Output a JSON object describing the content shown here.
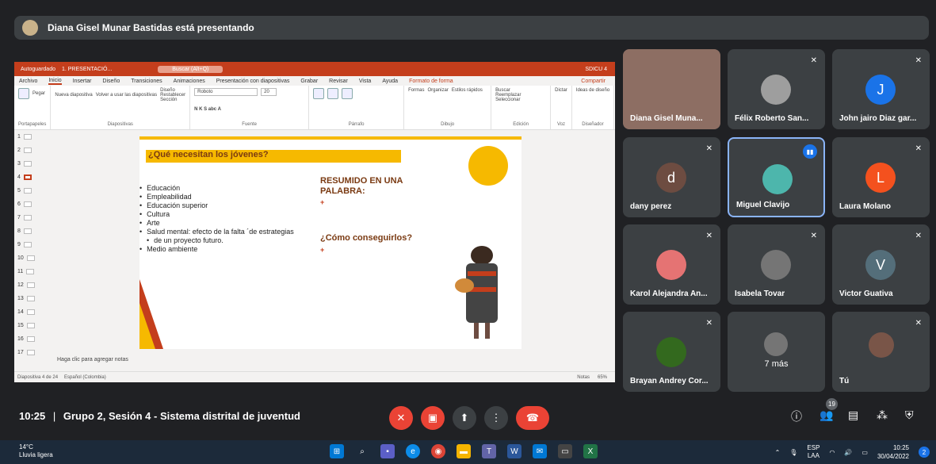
{
  "presenter_banner": "Diana Gisel Munar Bastidas está presentando",
  "ppt": {
    "autosave": "Autoguardado",
    "filename": "1. PRESENTACIÓ...",
    "search": "Buscar (Alt+Q)",
    "user": "SDICU 4",
    "menu": [
      "Archivo",
      "Inicio",
      "Insertar",
      "Diseño",
      "Transiciones",
      "Animaciones",
      "Presentación con diapositivas",
      "Grabar",
      "Revisar",
      "Vista",
      "Ayuda",
      "Formato de forma"
    ],
    "share": "Compartir",
    "groups": [
      "Portapapeles",
      "Diapositivas",
      "Fuente",
      "Párrafo",
      "Dibujo",
      "Edición",
      "Voz",
      "Diseñador"
    ],
    "paste": "Pegar",
    "new_slide": "Nueva diapositiva",
    "reuse": "Volver a usar las diapositivas",
    "layout": "Diseño",
    "reset": "Restablecer",
    "section": "Sección",
    "font": "Roboto",
    "size": "20",
    "forms": "Formas",
    "arrange": "Organizar",
    "styles": "Estilos rápidos",
    "find": "Buscar",
    "replace": "Reemplazar",
    "select": "Seleccionar",
    "dictate": "Dictar",
    "ideas": "Ideas de diseño",
    "slide_numbers": [
      "1",
      "2",
      "3",
      "4",
      "5",
      "6",
      "7",
      "8",
      "9",
      "10",
      "11",
      "12",
      "13",
      "14",
      "15",
      "16",
      "17"
    ],
    "notes_placeholder": "Haga clic para agregar notas",
    "status_slide": "Diapositiva 4 de 24",
    "status_lang": "Español (Colombia)",
    "status_notes": "Notas",
    "zoom": "65%"
  },
  "slide": {
    "question": "¿Qué necesitan los jóvenes?",
    "bullets": [
      "Educación",
      "Empleabilidad",
      "Educación superior",
      "Cultura",
      "Arte",
      "Salud mental: efecto de la falta ´de estrategias",
      "de un proyecto futuro.",
      "Medio ambiente"
    ],
    "resumido": "RESUMIDO EN UNA",
    "palabra": "PALABRA:",
    "como": "¿Cómo conseguirlos?"
  },
  "participants": [
    {
      "name": "Diana Gisel Muna...",
      "initial": "",
      "color": "#8d6e63",
      "muted": false
    },
    {
      "name": "Félix Roberto San...",
      "initial": "",
      "color": "#9e9e9e",
      "muted": true
    },
    {
      "name": "John jairo Diaz gar...",
      "initial": "J",
      "color": "#1a73e8",
      "muted": true
    },
    {
      "name": "dany perez",
      "initial": "d",
      "color": "#6d4c41",
      "muted": true
    },
    {
      "name": "Miguel Clavijo",
      "initial": "",
      "color": "#4db6ac",
      "muted": false
    },
    {
      "name": "Laura Molano",
      "initial": "L",
      "color": "#f4511e",
      "muted": true
    },
    {
      "name": "Karol Alejandra An...",
      "initial": "",
      "color": "#e57373",
      "muted": true
    },
    {
      "name": "Isabela Tovar",
      "initial": "",
      "color": "#757575",
      "muted": true
    },
    {
      "name": "Victor Guativa",
      "initial": "V",
      "color": "#546e7a",
      "muted": true
    },
    {
      "name": "Brayan Andrey Cor...",
      "initial": "",
      "color": "#33691e",
      "muted": true
    },
    {
      "name": "7 más",
      "initial": "",
      "color": "#5f6368",
      "muted": true
    },
    {
      "name": "Tú",
      "initial": "",
      "color": "#795548",
      "muted": false
    }
  ],
  "meeting": {
    "time": "10:25",
    "separator": "|",
    "title": "Grupo 2, Sesión 4 - Sistema distrital de juventud",
    "participants_count": "19"
  },
  "taskbar": {
    "temp": "14°C",
    "weather": "Lluvia ligera",
    "lang1": "ESP",
    "lang2": "LAA",
    "time": "10:25",
    "date": "30/04/2022",
    "notif": "2"
  }
}
